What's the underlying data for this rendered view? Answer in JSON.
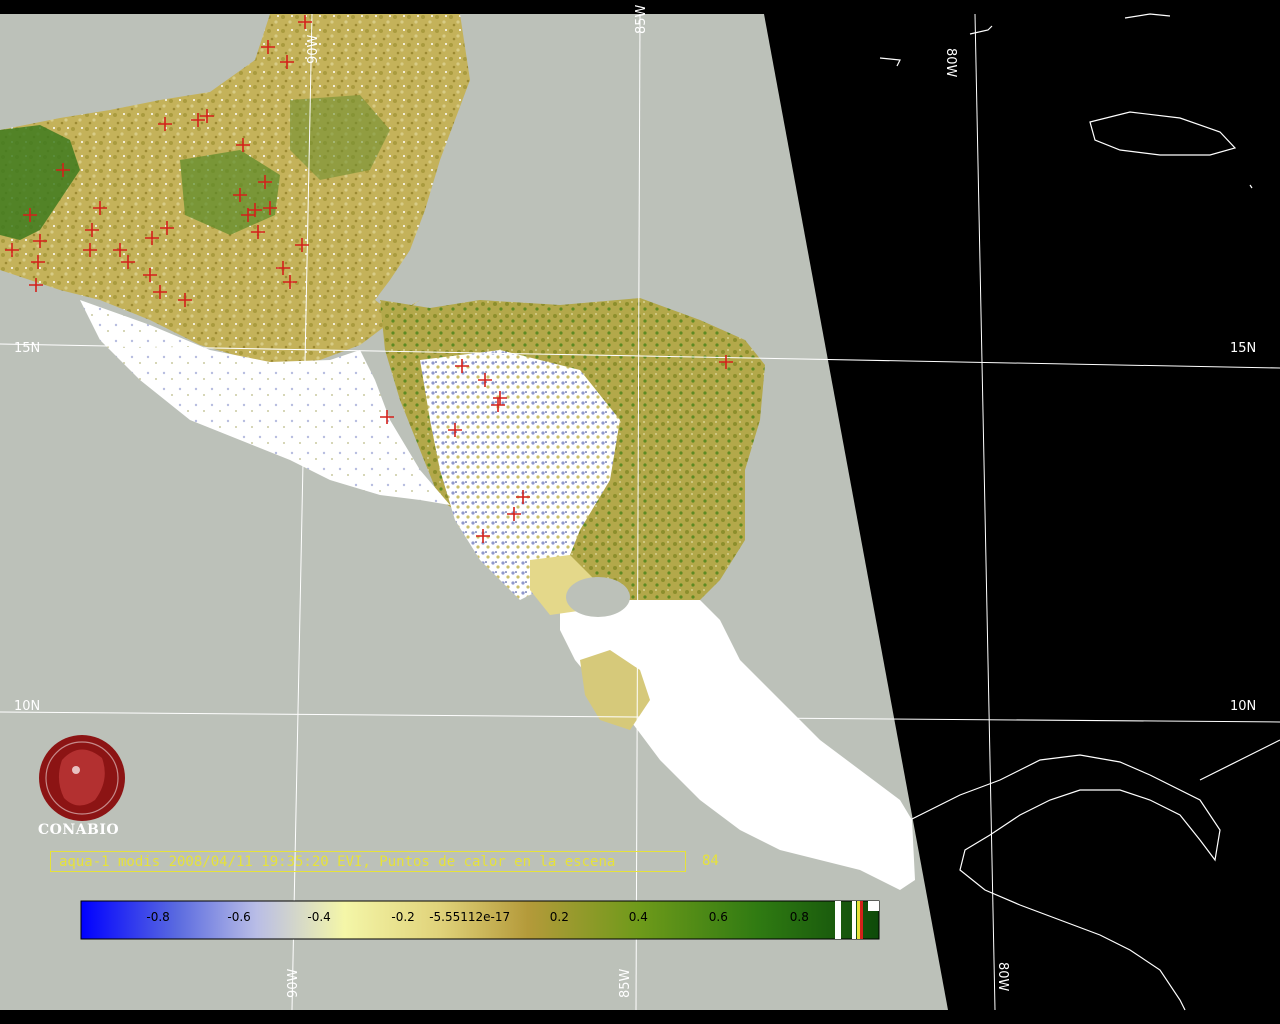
{
  "map": {
    "colors": {
      "space": "#000000",
      "ocean": "#bcc1b9",
      "cloud": "#ffffff",
      "veg_low": "#c8b45a",
      "veg_mid": "#a8a040",
      "veg_high": "#3e7a1e",
      "grid": "#ffffff",
      "fire": "#d4201a",
      "caption": "#e6e23a"
    },
    "grid_labels": {
      "lat_15_left": "15N",
      "lat_15_right": "15N",
      "lat_10_left": "10N",
      "lat_10_right": "10N",
      "lon_85_top": "85W",
      "lon_80_top": "80W",
      "lon_90_top": "90W",
      "lon_90_bottom": "90W",
      "lon_85_bottom": "85W",
      "lon_80_bottom": "80W"
    },
    "logo": {
      "name": "CONABIO"
    },
    "caption": {
      "text": "aqua-1 modis 2008/04/11 19:35:20 EVI, Puntos de calor en la escena",
      "count": "84"
    },
    "colorbar": {
      "ticks": [
        "-0.8",
        "-0.6",
        "-0.4",
        "-0.2",
        "-5.55112e-17",
        "0.2",
        "0.4",
        "0.6",
        "0.8"
      ]
    }
  }
}
